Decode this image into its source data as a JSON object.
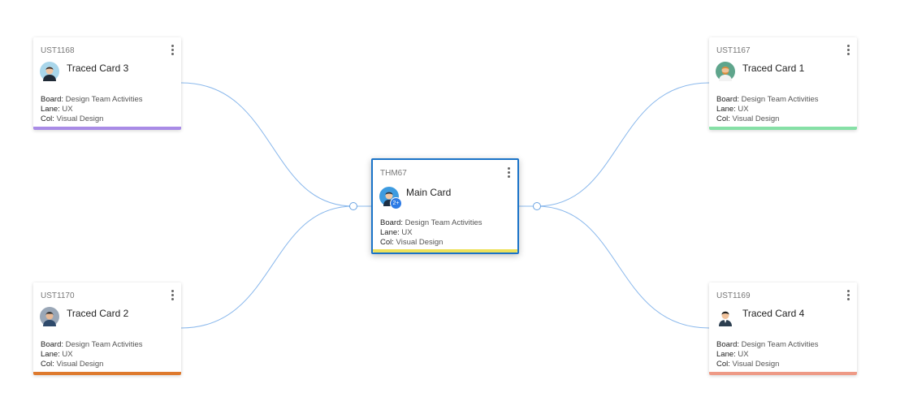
{
  "colors": {
    "link_line": "#8ab8ec",
    "main_border": "#1a73c8"
  },
  "labels": {
    "board": "Board:",
    "lane": "Lane:",
    "col": "Col:"
  },
  "main_card": {
    "id": "THM67",
    "title": "Main Card",
    "board": "Design Team Activities",
    "lane": "UX",
    "col": "Visual Design",
    "bar_color": "#ede15a",
    "avatar_icon": "user-group-avatar-icon",
    "badge": "2+"
  },
  "cards": {
    "c3": {
      "id": "UST1168",
      "title": "Traced Card 3",
      "board": "Design Team Activities",
      "lane": "UX",
      "col": "Visual Design",
      "bar_color": "#a98be6",
      "avatar_icon": "woman-avatar-icon"
    },
    "c2": {
      "id": "UST1170",
      "title": "Traced Card 2",
      "board": "Design Team Activities",
      "lane": "UX",
      "col": "Visual Design",
      "bar_color": "#de7a2e",
      "avatar_icon": "man-avatar-icon"
    },
    "c1": {
      "id": "UST1167",
      "title": "Traced Card 1",
      "board": "Design Team Activities",
      "lane": "UX",
      "col": "Visual Design",
      "bar_color": "#86e0a6",
      "avatar_icon": "bearded-man-avatar-icon"
    },
    "c4": {
      "id": "UST1169",
      "title": "Traced Card 4",
      "board": "Design Team Activities",
      "lane": "UX",
      "col": "Visual Design",
      "bar_color": "#ee9a86",
      "avatar_icon": "suited-man-avatar-icon"
    }
  }
}
